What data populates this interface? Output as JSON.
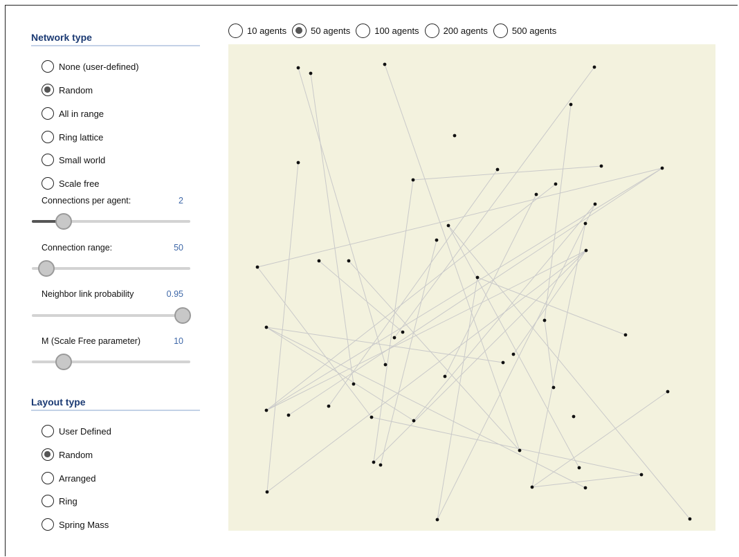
{
  "network": {
    "title": "Network type",
    "options": [
      "None (user-defined)",
      "Random",
      "All in range",
      "Ring lattice",
      "Small world",
      "Scale free"
    ],
    "selected": "Random"
  },
  "sliders": [
    {
      "label": "Connections per agent:",
      "value": "2",
      "level": 0.2
    },
    {
      "label": "Connection range:",
      "value": "50",
      "level": 0.09
    },
    {
      "label": "Neighbor link probability",
      "value": "0.95",
      "level": 0.95
    },
    {
      "label": "M (Scale Free parameter)",
      "value": "10",
      "level": 0.2
    }
  ],
  "layout": {
    "title": "Layout type",
    "options": [
      "User Defined",
      "Random",
      "Arranged",
      "Ring",
      "Spring Mass"
    ],
    "selected": "Random"
  },
  "agents": {
    "options": [
      "10 agents",
      "50 agents",
      "100 agents",
      "200 agents",
      "500 agents"
    ],
    "selected": "50 agents"
  },
  "colors": {
    "canvas_bg": "#f3f2de",
    "link": "#c9c9c9",
    "node": "#111111",
    "section_title": "#1b3a73",
    "value_text": "#3f68a8"
  }
}
